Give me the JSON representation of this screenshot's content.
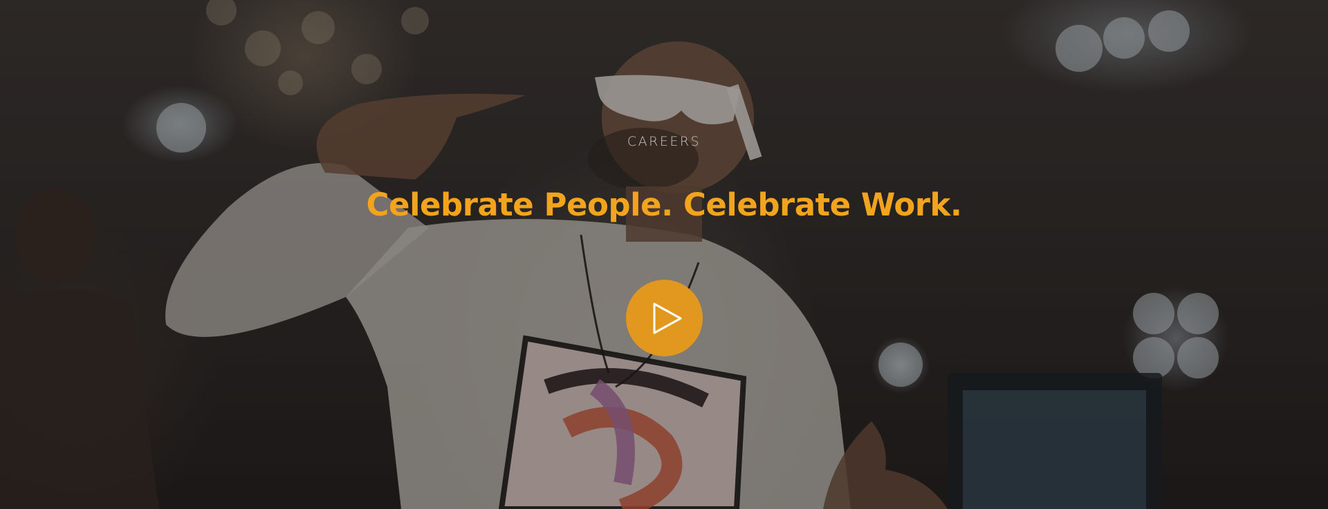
{
  "hero": {
    "eyebrow": "CAREERS",
    "headline": "Celebrate People. Celebrate Work.",
    "play_button_icon": "play-icon"
  },
  "colors": {
    "accent": "#f2a41c",
    "play_button": "#e2981f",
    "eyebrow_text": "#c9c6c3"
  }
}
